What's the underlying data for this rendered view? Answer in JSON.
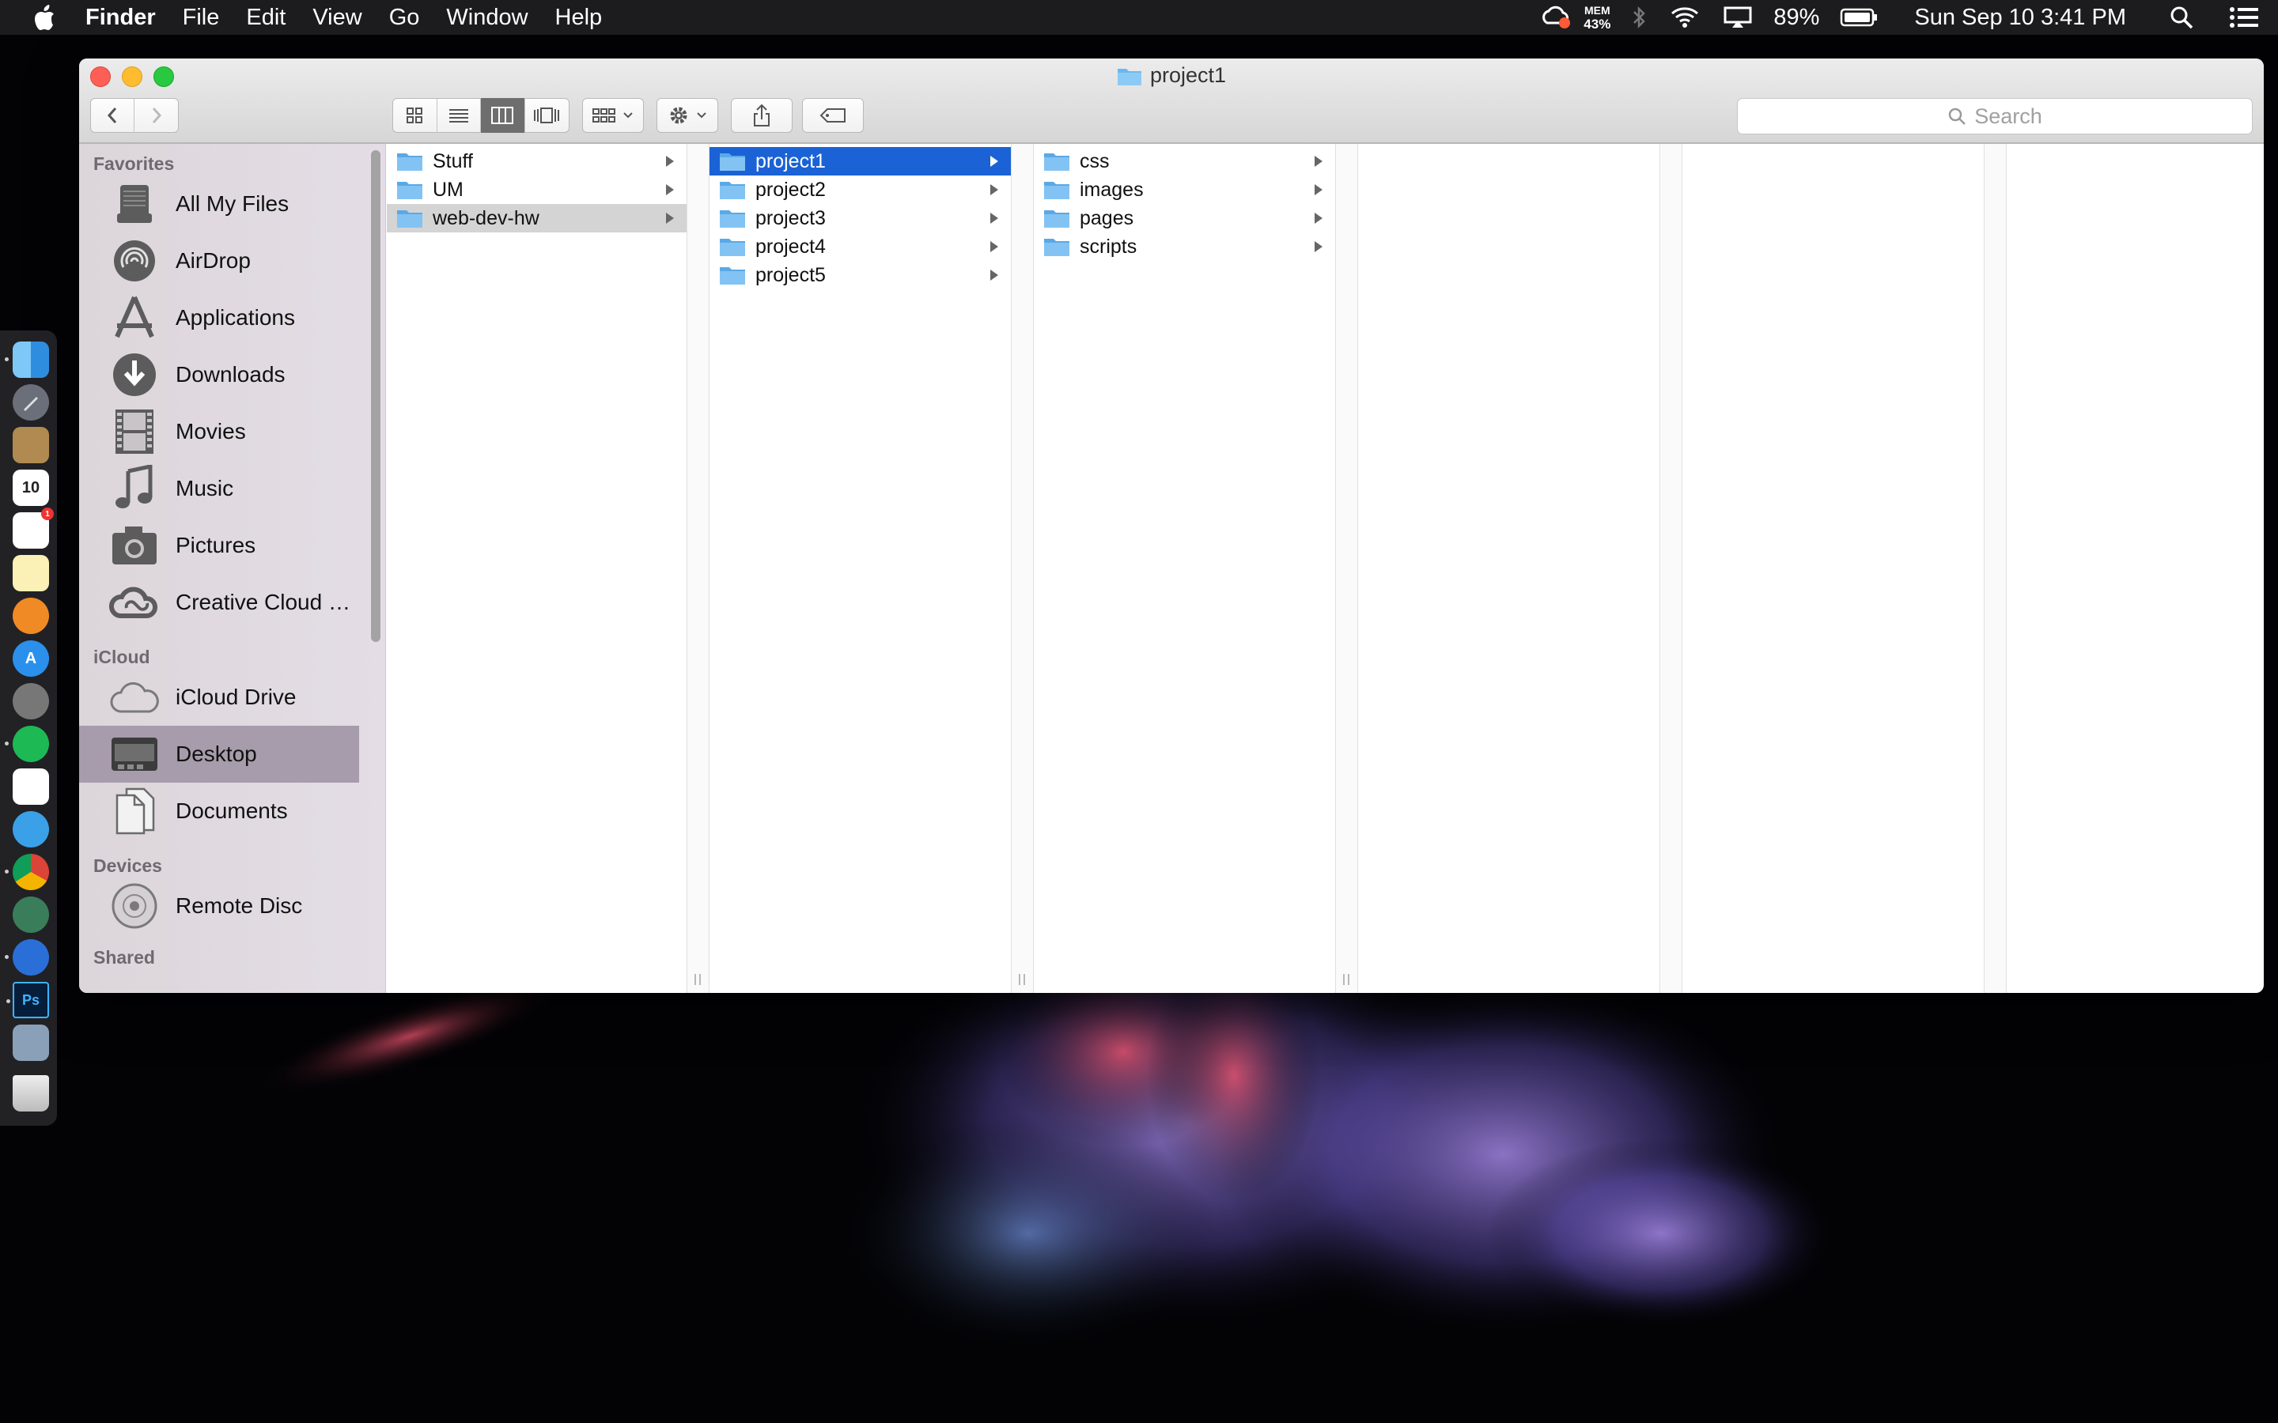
{
  "menubar": {
    "app_name": "Finder",
    "menus": [
      "File",
      "Edit",
      "View",
      "Go",
      "Window",
      "Help"
    ],
    "status": {
      "mem_label": "MEM",
      "mem_value": "43%",
      "battery": "89%",
      "datetime": "Sun Sep 10  3:41 PM"
    }
  },
  "window": {
    "title": "project1",
    "search": {
      "placeholder": "Search"
    }
  },
  "sidebar": {
    "sections": {
      "favorites": "Favorites",
      "icloud": "iCloud",
      "devices": "Devices",
      "shared": "Shared"
    },
    "favorites": [
      {
        "label": "All My Files",
        "icon": "all-files-icon"
      },
      {
        "label": "AirDrop",
        "icon": "airdrop-icon"
      },
      {
        "label": "Applications",
        "icon": "applications-icon"
      },
      {
        "label": "Downloads",
        "icon": "downloads-icon"
      },
      {
        "label": "Movies",
        "icon": "movies-icon"
      },
      {
        "label": "Music",
        "icon": "music-icon"
      },
      {
        "label": "Pictures",
        "icon": "pictures-icon"
      },
      {
        "label": "Creative Cloud Fil...",
        "icon": "creative-cloud-icon"
      }
    ],
    "icloud": [
      {
        "label": "iCloud Drive",
        "icon": "cloud-icon"
      },
      {
        "label": "Desktop",
        "icon": "desktop-icon",
        "selected": true
      },
      {
        "label": "Documents",
        "icon": "documents-icon"
      }
    ],
    "devices": [
      {
        "label": "Remote Disc",
        "icon": "disc-icon"
      }
    ]
  },
  "columns": [
    {
      "items": [
        "Stuff",
        "UM",
        "web-dev-hw"
      ],
      "selected": "web-dev-hw"
    },
    {
      "items": [
        "project1",
        "project2",
        "project3",
        "project4",
        "project5"
      ],
      "selected": "project1"
    },
    {
      "items": [
        "css",
        "images",
        "pages",
        "scripts"
      ],
      "selected": null
    }
  ],
  "colors": {
    "selection_blue": "#1a62d6",
    "folder_blue": "#6bb8f0",
    "sidebar_selected": "#a79cac"
  }
}
